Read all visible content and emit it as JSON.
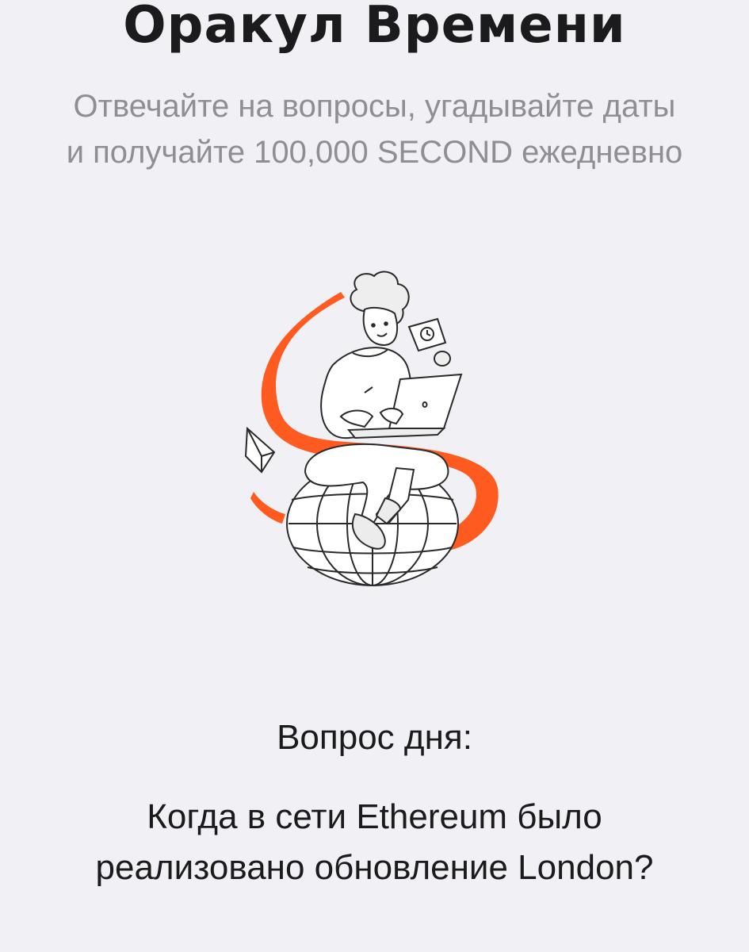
{
  "header": {
    "title": "Оракул Времени",
    "subtitle_line1": "Отвечайте на вопросы, угадывайте даты",
    "subtitle_line2": "и получайте 100,000 SECOND ежедневно"
  },
  "hero": {
    "illustration": "person-with-laptop-on-globe",
    "accent_color": "#ff5a1f"
  },
  "question": {
    "label": "Вопрос дня:",
    "line1": "Когда в сети Ethereum было",
    "line2": "реализовано обновление London?"
  }
}
